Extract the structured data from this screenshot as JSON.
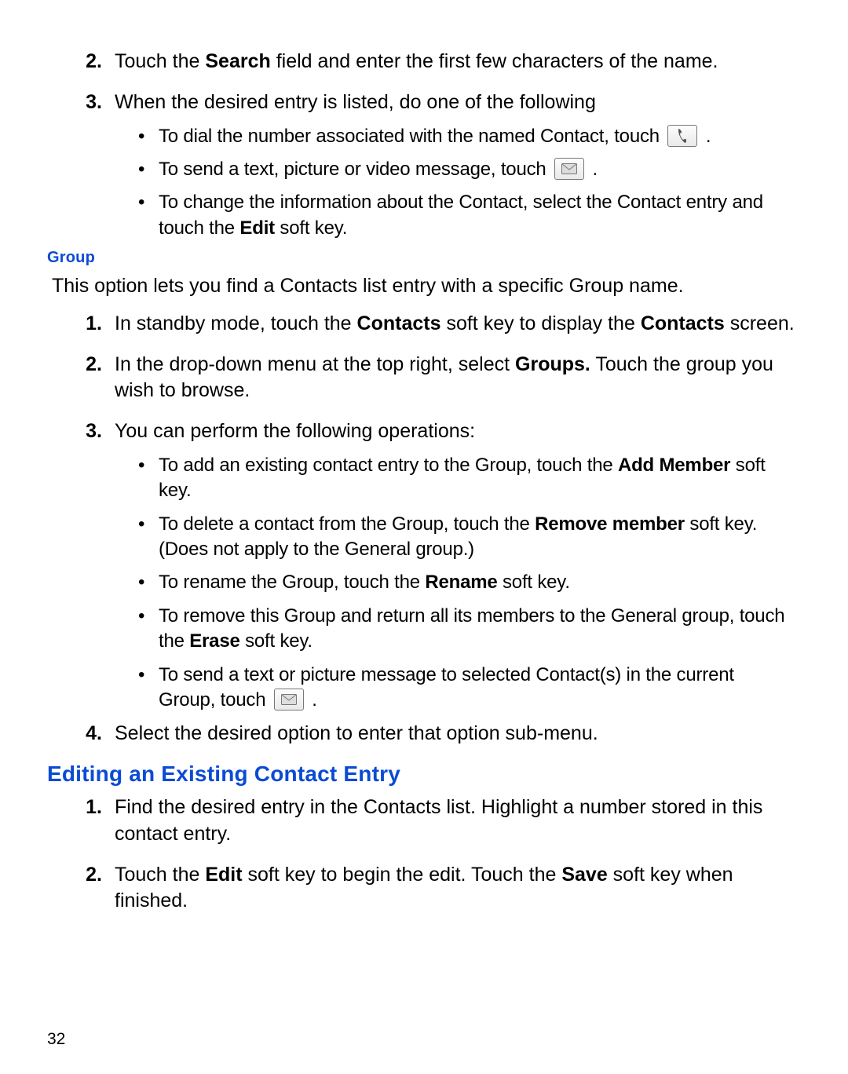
{
  "section_a": {
    "step2": {
      "num": "2.",
      "parts": [
        "Touch the ",
        "Search",
        " field and enter the first few characters of the name."
      ]
    },
    "step3": {
      "num": "3.",
      "text": "When the desired entry is listed, do one of the following",
      "bullets": [
        {
          "pre": "To dial the number associated with the named Contact, touch ",
          "icon": "phone",
          "post": "."
        },
        {
          "pre": "To send a text, picture or video message, touch ",
          "icon": "envelope",
          "post": "."
        },
        {
          "plain_parts": [
            "To change the information about the Contact, select the Contact entry and touch the ",
            "Edit",
            " soft key."
          ]
        }
      ]
    }
  },
  "group_heading": "Group",
  "group_intro": "This option lets you find a Contacts list entry with a specific Group name.",
  "group_steps": {
    "s1": {
      "num": "1.",
      "parts": [
        "In standby mode, touch the ",
        "Contacts",
        " soft key to display the ",
        "Contacts",
        " screen."
      ]
    },
    "s2": {
      "num": "2.",
      "parts": [
        "In the drop-down menu at the top right, select ",
        "Groups.",
        " Touch the group you wish to browse."
      ]
    },
    "s3": {
      "num": "3.",
      "text": "You can perform the following operations:",
      "bullets": [
        {
          "plain_parts": [
            "To add an existing contact entry to the Group, touch the ",
            "Add Member",
            " soft key."
          ]
        },
        {
          "plain_parts": [
            "To delete a contact from the Group, touch the ",
            "Remove member",
            " soft key. (Does not apply to the General group.)"
          ]
        },
        {
          "plain_parts": [
            "To rename the Group, touch the ",
            "Rename",
            " soft key."
          ]
        },
        {
          "plain_parts": [
            "To remove this Group and return all its members to the General group, touch the ",
            "Erase",
            " soft key."
          ]
        },
        {
          "pre": "To send a text or picture message to selected Contact(s) in the current Group, touch ",
          "icon": "envelope",
          "post": "."
        }
      ]
    },
    "s4": {
      "num": "4.",
      "text": "Select the desired option to enter that option sub-menu."
    }
  },
  "edit_heading": "Editing an Existing Contact Entry",
  "edit_steps": {
    "s1": {
      "num": "1.",
      "text": "Find the desired entry in the Contacts list. Highlight a number stored in this contact entry."
    },
    "s2": {
      "num": "2.",
      "parts": [
        "Touch the ",
        "Edit",
        " soft key to begin the edit. Touch the ",
        "Save",
        " soft key when finished."
      ]
    }
  },
  "page_number": "32"
}
